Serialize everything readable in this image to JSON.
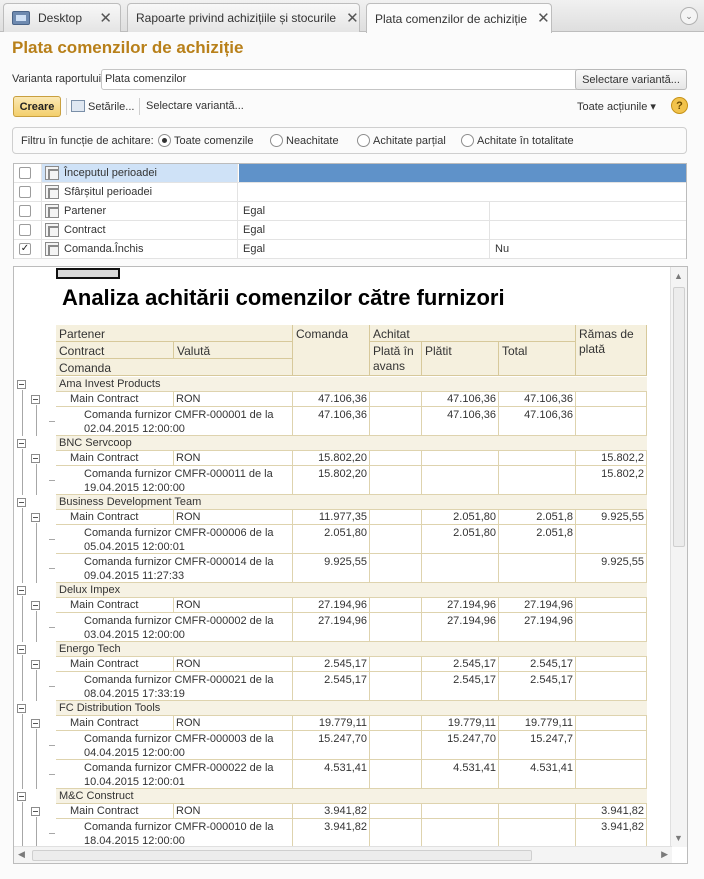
{
  "tabs": [
    {
      "label": "Desktop",
      "close": "✕"
    },
    {
      "label": "Rapoarte privind achizițiile și stocurile",
      "close": "✕"
    },
    {
      "label": "Plata comenzilor de achiziție",
      "close": "✕"
    }
  ],
  "tab_menu": "⌄",
  "page_title": "Plata comenzilor de achiziție",
  "variant": {
    "label": "Varianta raportului:",
    "value": "Plata comenzilor",
    "select_button": "Selectare variantă..."
  },
  "toolbar": {
    "create": "Creare",
    "settings": "Setările...",
    "select_variant": "Selectare variantă...",
    "all_actions": "Toate acțiunile ▾",
    "help": "?"
  },
  "filter": {
    "label": "Filtru în funcție de achitare:",
    "options": [
      "Toate comenzile",
      "Neachitate",
      "Achitate parțial",
      "Achitate în totalitate"
    ],
    "selected": "Toate comenzile"
  },
  "settings_rows": [
    {
      "checked": false,
      "name": "Începutul perioadei",
      "comparison": "",
      "value": ""
    },
    {
      "checked": false,
      "name": "Sfârșitul perioadei",
      "comparison": "",
      "value": ""
    },
    {
      "checked": false,
      "name": "Partener",
      "comparison": "Egal",
      "value": ""
    },
    {
      "checked": false,
      "name": "Contract",
      "comparison": "Egal",
      "value": ""
    },
    {
      "checked": true,
      "name": "Comanda.Închis",
      "comparison": "Egal",
      "value": "Nu"
    }
  ],
  "report": {
    "title": "Analiza achitării comenzilor către  furnizori",
    "headers": {
      "partener": "Partener",
      "contract": "Contract",
      "valuta": "Valută",
      "comanda_row": "Comanda",
      "comanda": "Comanda",
      "achitat": "Achitat",
      "plata_avans": "Plată în avans",
      "platit": "Plătit",
      "total": "Total",
      "ramas": "Rămas de plată"
    },
    "groups": [
      {
        "partner": "Ama Invest Products",
        "contract": "Main Contract",
        "currency": "RON",
        "comanda": "47.106,36",
        "avans": "",
        "platit": "47.106,36",
        "total": "47.106,36",
        "ramas": "",
        "orders": [
          {
            "l1": "Comanda furnizor CMFR-000001 de la",
            "l2": "02.04.2015 12:00:00",
            "comanda": "47.106,36",
            "avans": "",
            "platit": "47.106,36",
            "total": "47.106,36",
            "ramas": ""
          }
        ]
      },
      {
        "partner": "BNC Servcoop",
        "contract": "Main Contract",
        "currency": "RON",
        "comanda": "15.802,20",
        "avans": "",
        "platit": "",
        "total": "",
        "ramas": "15.802,2",
        "orders": [
          {
            "l1": "Comanda furnizor CMFR-000011 de la",
            "l2": "19.04.2015 12:00:00",
            "comanda": "15.802,20",
            "avans": "",
            "platit": "",
            "total": "",
            "ramas": "15.802,2"
          }
        ]
      },
      {
        "partner": "Business Development Team",
        "contract": "Main Contract",
        "currency": "RON",
        "comanda": "11.977,35",
        "avans": "",
        "platit": "2.051,80",
        "total": "2.051,8",
        "ramas": "9.925,55",
        "orders": [
          {
            "l1": "Comanda furnizor CMFR-000006 de la",
            "l2": "05.04.2015 12:00:01",
            "comanda": "2.051,80",
            "avans": "",
            "platit": "2.051,80",
            "total": "2.051,8",
            "ramas": ""
          },
          {
            "l1": "Comanda furnizor CMFR-000014 de la",
            "l2": "09.04.2015 11:27:33",
            "comanda": "9.925,55",
            "avans": "",
            "platit": "",
            "total": "",
            "ramas": "9.925,55"
          }
        ]
      },
      {
        "partner": "Delux Impex",
        "contract": "Main Contract",
        "currency": "RON",
        "comanda": "27.194,96",
        "avans": "",
        "platit": "27.194,96",
        "total": "27.194,96",
        "ramas": "",
        "orders": [
          {
            "l1": "Comanda furnizor CMFR-000002 de la",
            "l2": "03.04.2015 12:00:00",
            "comanda": "27.194,96",
            "avans": "",
            "platit": "27.194,96",
            "total": "27.194,96",
            "ramas": ""
          }
        ]
      },
      {
        "partner": "Energo Tech",
        "contract": "Main Contract",
        "currency": "RON",
        "comanda": "2.545,17",
        "avans": "",
        "platit": "2.545,17",
        "total": "2.545,17",
        "ramas": "",
        "orders": [
          {
            "l1": "Comanda furnizor CMFR-000021 de la",
            "l2": "08.04.2015 17:33:19",
            "comanda": "2.545,17",
            "avans": "",
            "platit": "2.545,17",
            "total": "2.545,17",
            "ramas": ""
          }
        ]
      },
      {
        "partner": "FC Distribution Tools",
        "contract": "Main Contract",
        "currency": "RON",
        "comanda": "19.779,11",
        "avans": "",
        "platit": "19.779,11",
        "total": "19.779,11",
        "ramas": "",
        "orders": [
          {
            "l1": "Comanda furnizor CMFR-000003 de la",
            "l2": "04.04.2015 12:00:00",
            "comanda": "15.247,70",
            "avans": "",
            "platit": "15.247,70",
            "total": "15.247,7",
            "ramas": ""
          },
          {
            "l1": "Comanda furnizor CMFR-000022 de la",
            "l2": "10.04.2015 12:00:01",
            "comanda": "4.531,41",
            "avans": "",
            "platit": "4.531,41",
            "total": "4.531,41",
            "ramas": ""
          }
        ]
      },
      {
        "partner": "M&C Construct",
        "contract": "Main Contract",
        "currency": "RON",
        "comanda": "3.941,82",
        "avans": "",
        "platit": "",
        "total": "",
        "ramas": "3.941,82",
        "orders": [
          {
            "l1": "Comanda furnizor CMFR-000010 de la",
            "l2": "18.04.2015 12:00:00",
            "comanda": "3.941,82",
            "avans": "",
            "platit": "",
            "total": "",
            "ramas": "3.941,82"
          }
        ]
      }
    ]
  },
  "colors": {
    "accent_title": "#b8801a",
    "selected_row": "#5f92c9",
    "header_bg": "#f5f0de",
    "create_button": "#f3cf6c"
  }
}
